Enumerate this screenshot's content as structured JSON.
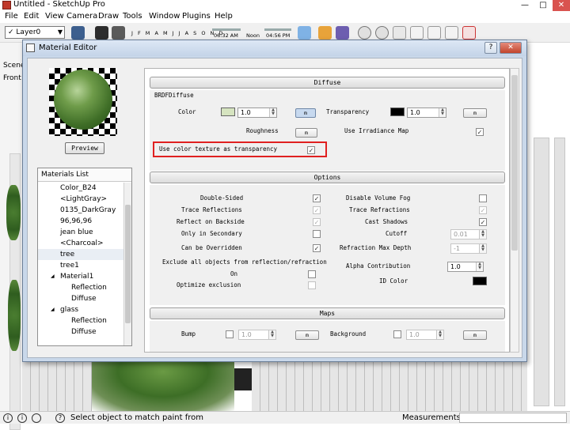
{
  "window": {
    "title": "Untitled - SketchUp Pro",
    "minimize": "—",
    "maximize": "□",
    "close": "✕"
  },
  "menu": [
    "File",
    "Edit",
    "View",
    "Camera",
    "Draw",
    "Tools",
    "Window",
    "Plugins",
    "Help"
  ],
  "toolbar": {
    "layer_value": "Layer0",
    "layer_check": "✓",
    "months": "J F M A M J J A S O N D",
    "time_start": "06:32 AM",
    "time_noon": "Noon",
    "time_end": "04:56 PM"
  },
  "left_strip": {
    "scenes_label": "Scene",
    "front_label": "Front"
  },
  "dialog": {
    "title": "Material Editor",
    "help": "?",
    "pin": "📌",
    "close": "✕",
    "preview_button": "Preview",
    "materials_list": {
      "header": "Materials List",
      "items": [
        {
          "label": "Color_B24",
          "expander": "",
          "child": false
        },
        {
          "label": "<LightGray>",
          "expander": "",
          "child": false
        },
        {
          "label": "0135_DarkGray",
          "expander": "",
          "child": false
        },
        {
          "label": "96,96,96",
          "expander": "",
          "child": false
        },
        {
          "label": "jean blue",
          "expander": "",
          "child": false
        },
        {
          "label": "<Charcoal>",
          "expander": "",
          "child": false
        },
        {
          "label": "tree",
          "expander": "",
          "child": false,
          "selected": true
        },
        {
          "label": "tree1",
          "expander": "",
          "child": false
        },
        {
          "label": "Material1",
          "expander": "◢",
          "child": false
        },
        {
          "label": "Reflection",
          "expander": "",
          "child": true
        },
        {
          "label": "Diffuse",
          "expander": "",
          "child": true
        },
        {
          "label": "glass",
          "expander": "◢",
          "child": false
        },
        {
          "label": "Reflection",
          "expander": "",
          "child": true
        },
        {
          "label": "Diffuse",
          "expander": "",
          "child": true
        }
      ]
    },
    "diffuse": {
      "header": "Diffuse",
      "sub": "BRDFDiffuse",
      "color_label": "Color",
      "color_value": "1.0",
      "color_swatch": "#d6e4c0",
      "color_map_btn": "m",
      "transparency_label": "Transparency",
      "transparency_value": "1.0",
      "transparency_swatch": "#000000",
      "transparency_map_btn": "m",
      "roughness_label": "Roughness",
      "roughness_map_btn": "m",
      "irradiance_label": "Use Irradiance Map",
      "irradiance_check": "✓",
      "color_texture_label": "Use color texture as transparency",
      "color_texture_check": "✓"
    },
    "options": {
      "header": "Options",
      "double_sided": "Double-Sided",
      "double_sided_check": "✓",
      "trace_reflections": "Trace Reflections",
      "trace_reflections_check": "✓",
      "reflect_backside": "Reflect on Backside",
      "reflect_backside_check": "✓",
      "only_secondary": "Only in Secondary",
      "only_secondary_check": "",
      "can_be_overridden": "Can be Overridden",
      "can_be_overridden_check": "✓",
      "exclude_all": "Exclude all objects from reflection/refraction",
      "on_label": "On",
      "on_check": "",
      "optimize_label": "Optimize exclusion",
      "optimize_check": "",
      "disable_fog": "Disable Volume Fog",
      "disable_fog_check": "",
      "trace_refractions": "Trace Refractions",
      "trace_refractions_check": "✓",
      "cast_shadows": "Cast Shadows",
      "cast_shadows_check": "✓",
      "cutoff_label": "Cutoff",
      "cutoff_value": "0.01",
      "refraction_depth_label": "Refraction Max Depth",
      "refraction_depth_value": "-1",
      "alpha_label": "Alpha Contribution",
      "alpha_value": "1.0",
      "id_color_label": "ID Color",
      "id_color_swatch": "#000000"
    },
    "maps": {
      "header": "Maps",
      "bump_label": "Bump",
      "bump_value": "1.0",
      "bump_map_btn": "m",
      "background_label": "Background",
      "background_value": "1.0",
      "background_map_btn": "m"
    }
  },
  "status": {
    "hint": "Select object to match paint from",
    "measurements_label": "Measurements",
    "icon_1": "i",
    "icon_2": "i",
    "icon_3": "?"
  }
}
